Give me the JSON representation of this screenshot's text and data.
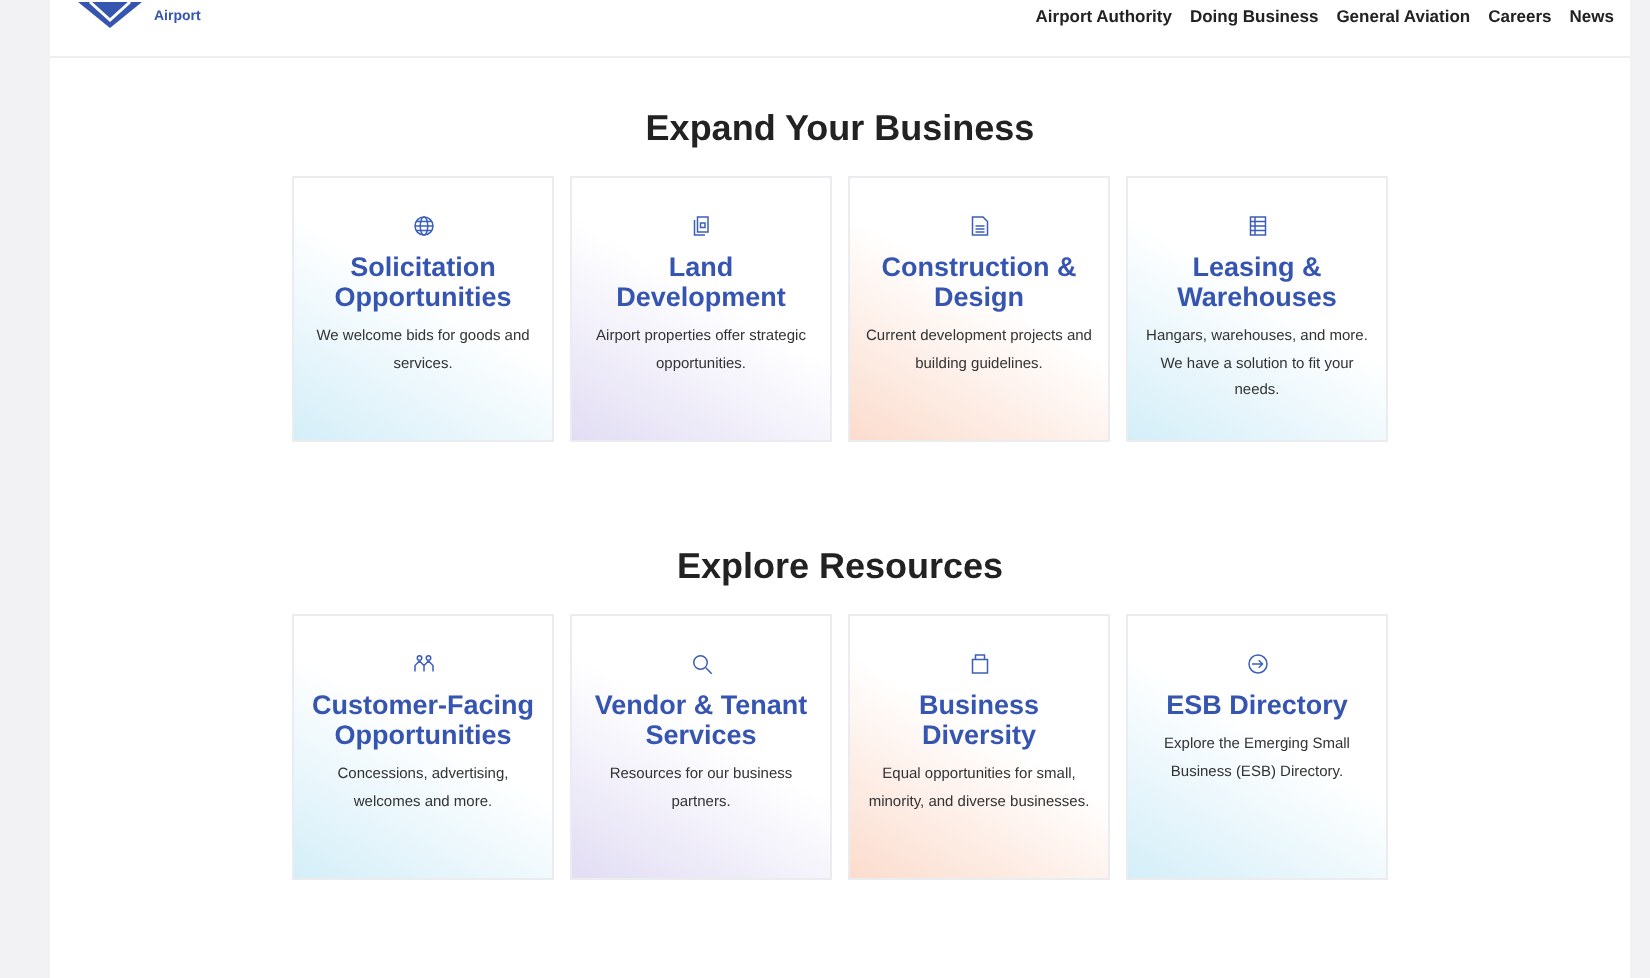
{
  "header": {
    "logo_text": "Airport",
    "nav": [
      {
        "label": "Airport Authority"
      },
      {
        "label": "Doing Business"
      },
      {
        "label": "General Aviation"
      },
      {
        "label": "Careers"
      },
      {
        "label": "News"
      }
    ]
  },
  "sections": [
    {
      "title": "Expand Your Business",
      "cards": [
        {
          "title": "Solicitation Opportunities",
          "text": "We welcome bids for goods and services.",
          "color": "#d4eef8"
        },
        {
          "title": "Land Development",
          "text": "Airport properties offer strategic opportunities.",
          "color": "#e2ddf4"
        },
        {
          "title": "Construction & Design",
          "text": "Current development projects and building guidelines.",
          "color": "#fbdccd"
        },
        {
          "title": "Leasing & Warehouses",
          "text": "Hangars, warehouses, and more. We have a solution to fit your needs.",
          "color": "#d4eef8"
        }
      ]
    },
    {
      "title": "Explore Resources",
      "cards": [
        {
          "title": "Customer-Facing Opportunities",
          "text": "Concessions, advertising, welcomes and more.",
          "color": "#d4eef8"
        },
        {
          "title": "Vendor & Tenant Services",
          "text": "Resources for our business partners.",
          "color": "#e2ddf4"
        },
        {
          "title": "Business Diversity",
          "text": "Equal opportunities for small, minority, and diverse businesses.",
          "color": "#fbdccd"
        },
        {
          "title": "ESB Directory",
          "text": "Explore the Emerging Small Business (ESB) Directory.",
          "color": "#d4eef8"
        }
      ]
    }
  ]
}
